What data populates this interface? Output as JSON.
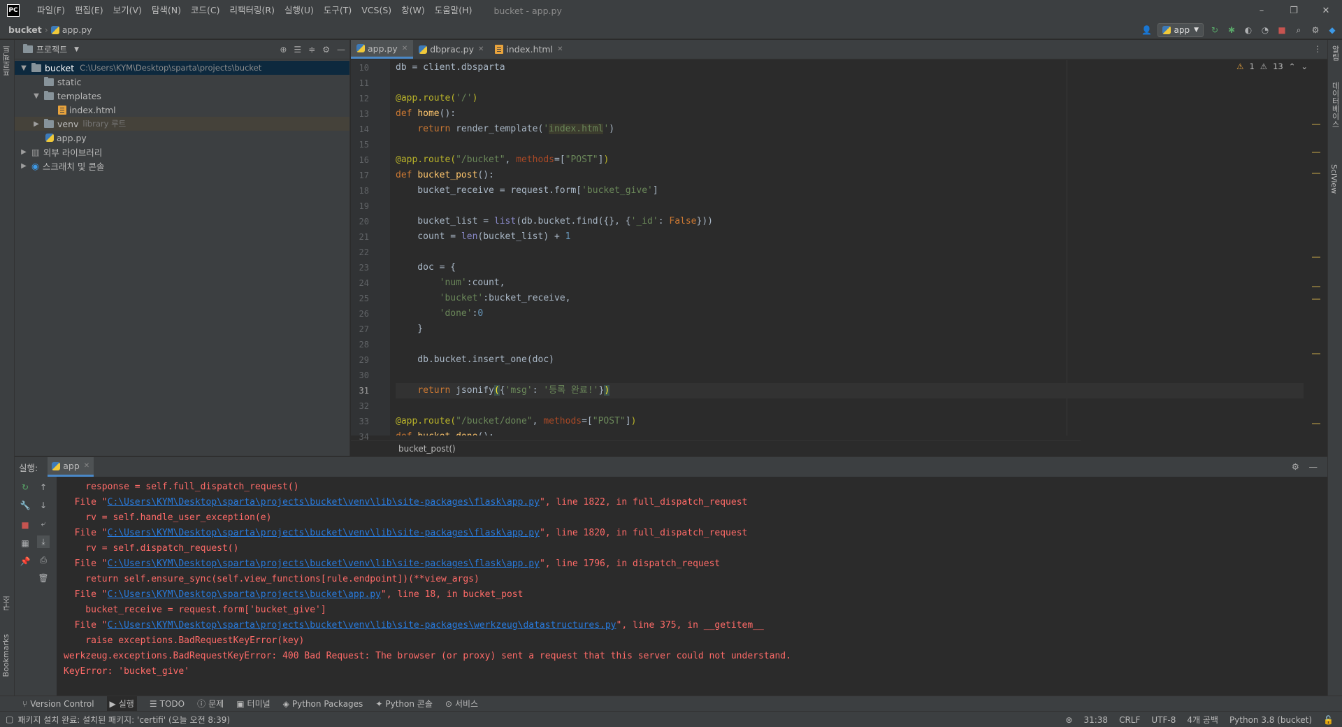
{
  "window": {
    "logo_text": "PC",
    "title": "bucket - app.py",
    "menu": [
      "파일(F)",
      "편집(E)",
      "보기(V)",
      "탐색(N)",
      "코드(C)",
      "리팩터링(R)",
      "실행(U)",
      "도구(T)",
      "VCS(S)",
      "창(W)",
      "도움말(H)"
    ],
    "controls": {
      "minimize": "–",
      "restore": "❐",
      "close": "✕"
    }
  },
  "navbar": {
    "project": "bucket",
    "file": "app.py",
    "run_config": "app"
  },
  "left_stripe": {
    "project_tab": "프로젝트",
    "structure_tab": "구조",
    "bookmarks_tab": "Bookmarks"
  },
  "right_stripe": {
    "notifications": "알림",
    "database": "데이터베이스",
    "sciview": "SciView"
  },
  "project": {
    "header": "프로젝트",
    "tree": [
      {
        "label": "bucket",
        "hint": "C:\\Users\\KYM\\Desktop\\sparta\\projects\\bucket",
        "depth": 0,
        "type": "folder",
        "expanded": true
      },
      {
        "label": "static",
        "depth": 1,
        "type": "folder"
      },
      {
        "label": "templates",
        "depth": 1,
        "type": "folder",
        "expanded": true
      },
      {
        "label": "index.html",
        "depth": 2,
        "type": "html"
      },
      {
        "label": "venv",
        "hint": "library 루트",
        "depth": 1,
        "type": "folder",
        "collapsed": true
      },
      {
        "label": "app.py",
        "depth": 1,
        "type": "py"
      },
      {
        "label": "외부 라이브러리",
        "depth": 0,
        "type": "lib",
        "collapsed": true
      },
      {
        "label": "스크래치 및 콘솔",
        "depth": 0,
        "type": "scratch",
        "collapsed": true
      }
    ]
  },
  "editor": {
    "tabs": [
      {
        "label": "app.py",
        "active": true
      },
      {
        "label": "dbprac.py",
        "active": false
      },
      {
        "label": "index.html",
        "active": false
      }
    ],
    "inspection": {
      "errors": "1",
      "warnings": "13"
    },
    "line_numbers": [
      "10",
      "11",
      "12",
      "13",
      "14",
      "15",
      "16",
      "17",
      "18",
      "19",
      "20",
      "21",
      "22",
      "23",
      "24",
      "25",
      "26",
      "27",
      "28",
      "29",
      "30",
      "31",
      "32",
      "33",
      "34"
    ],
    "current_line": "31",
    "breadcrumb": "bucket_post()"
  },
  "run": {
    "label": "실행:",
    "tab": "app",
    "console": {
      "l0": "    response = self.full_dispatch_request()",
      "l1a": "  File \"",
      "l1b": "C:\\Users\\KYM\\Desktop\\sparta\\projects\\bucket\\venv\\lib\\site-packages\\flask\\app.py",
      "l1c": "\", line 1822, in full_dispatch_request",
      "l2": "    rv = self.handle_user_exception(e)",
      "l3a": "  File \"",
      "l3b": "C:\\Users\\KYM\\Desktop\\sparta\\projects\\bucket\\venv\\lib\\site-packages\\flask\\app.py",
      "l3c": "\", line 1820, in full_dispatch_request",
      "l4": "    rv = self.dispatch_request()",
      "l5a": "  File \"",
      "l5b": "C:\\Users\\KYM\\Desktop\\sparta\\projects\\bucket\\venv\\lib\\site-packages\\flask\\app.py",
      "l5c": "\", line 1796, in dispatch_request",
      "l6": "    return self.ensure_sync(self.view_functions[rule.endpoint])(**view_args)",
      "l7a": "  File \"",
      "l7b": "C:\\Users\\KYM\\Desktop\\sparta\\projects\\bucket\\app.py",
      "l7c": "\", line 18, in bucket_post",
      "l8": "    bucket_receive = request.form['bucket_give']",
      "l9a": "  File \"",
      "l9b": "C:\\Users\\KYM\\Desktop\\sparta\\projects\\bucket\\venv\\lib\\site-packages\\werkzeug\\datastructures.py",
      "l9c": "\", line 375, in __getitem__",
      "l10": "    raise exceptions.BadRequestKeyError(key)",
      "l11": "werkzeug.exceptions.BadRequestKeyError: 400 Bad Request: The browser (or proxy) sent a request that this server could not understand.",
      "l12": "KeyError: 'bucket_give'"
    }
  },
  "bottom_tools": [
    "Version Control",
    "실행",
    "TODO",
    "문제",
    "터미널",
    "Python Packages",
    "Python 콘솔",
    "서비스"
  ],
  "status": {
    "message": "패키지 설치 완료: 설치된 패키지: 'certifi' (오늘 오전 8:39)",
    "position": "31:38",
    "line_sep": "CRLF",
    "encoding": "UTF-8",
    "indent": "4개 공백",
    "interpreter": "Python 3.8 (bucket)"
  }
}
